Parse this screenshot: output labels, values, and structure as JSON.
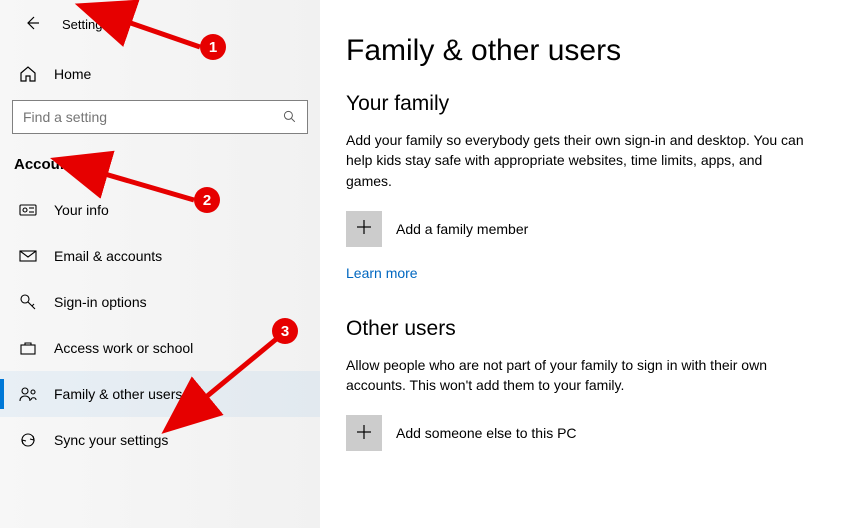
{
  "header": {
    "app_title": "Settings"
  },
  "sidebar": {
    "home_label": "Home",
    "search_placeholder": "Find a setting",
    "category_label": "Accounts",
    "items": [
      {
        "label": "Your info"
      },
      {
        "label": "Email & accounts"
      },
      {
        "label": "Sign-in options"
      },
      {
        "label": "Access work or school"
      },
      {
        "label": "Family & other users"
      },
      {
        "label": "Sync your settings"
      }
    ]
  },
  "main": {
    "page_title": "Family & other users",
    "family": {
      "heading": "Your family",
      "description": "Add your family so everybody gets their own sign-in and desktop. You can help kids stay safe with appropriate websites, time limits, apps, and games.",
      "add_label": "Add a family member",
      "learn_more": "Learn more"
    },
    "other": {
      "heading": "Other users",
      "description": "Allow people who are not part of your family to sign in with their own accounts. This won't add them to your family.",
      "add_label": "Add someone else to this PC"
    }
  },
  "annotations": {
    "1": "1",
    "2": "2",
    "3": "3"
  }
}
